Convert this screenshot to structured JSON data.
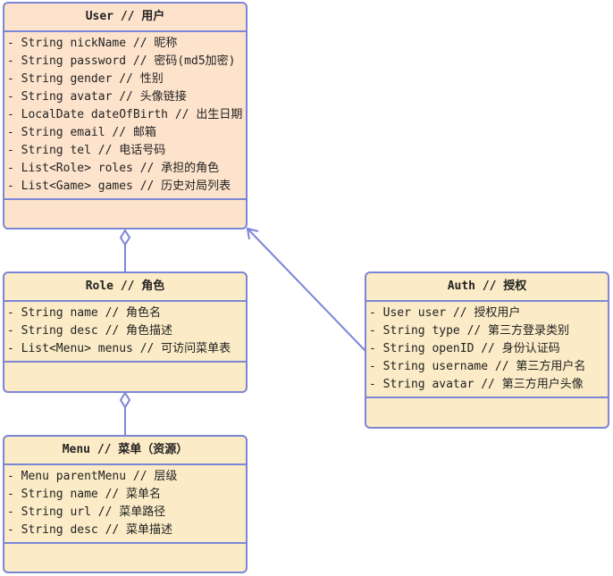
{
  "classes": {
    "user": {
      "title": "User // 用户",
      "attributes": [
        "- String nickName // 昵称",
        "- String password // 密码(md5加密)",
        "- String gender // 性别",
        "- String avatar // 头像链接",
        "- LocalDate dateOfBirth // 出生日期",
        "- String email // 邮箱",
        "- String tel // 电话号码",
        "- List<Role> roles // 承担的角色",
        "- List<Game> games // 历史对局列表"
      ]
    },
    "role": {
      "title": "Role // 角色",
      "attributes": [
        "- String name // 角色名",
        "- String desc // 角色描述",
        "- List<Menu> menus // 可访问菜单表"
      ]
    },
    "menu": {
      "title": "Menu // 菜单（资源）",
      "attributes": [
        "- Menu parentMenu // 层级",
        "- String name // 菜单名",
        "- String url // 菜单路径",
        "- String desc // 菜单描述"
      ]
    },
    "auth": {
      "title": "Auth // 授权",
      "attributes": [
        "- User user // 授权用户",
        "- String type // 第三方登录类别",
        "- String openID // 身份认证码",
        "- String username // 第三方用户名",
        "- String avatar // 第三方用户头像"
      ]
    }
  },
  "colors": {
    "border": "#7b86d6",
    "user_fill": "#fde3cc",
    "class_fill": "#fbebc6"
  }
}
